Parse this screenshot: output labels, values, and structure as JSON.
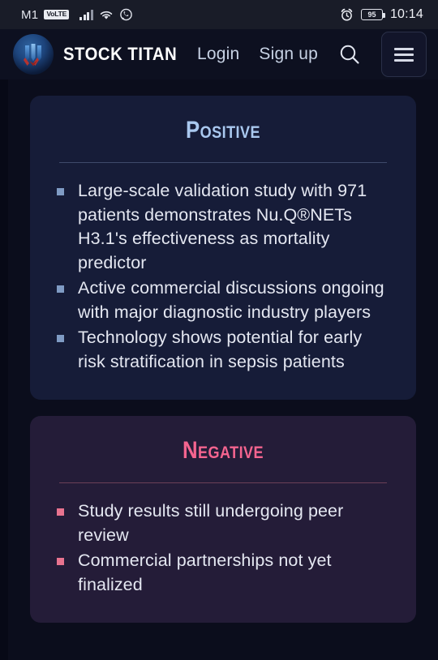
{
  "statusbar": {
    "carrier": "M1",
    "volte_badge": "VoLTE",
    "signal_icon": "signal-bars-icon",
    "wifi_icon": "wifi-icon",
    "whatsapp_icon": "whatsapp-icon",
    "alarm_icon": "alarm-clock-icon",
    "battery_level": "95",
    "time": "10:14"
  },
  "header": {
    "logo_icon": "stock-titan-logo-icon",
    "brand": "STOCK TITAN",
    "login_label": "Login",
    "signup_label": "Sign up",
    "search_icon": "search-icon",
    "menu_icon": "hamburger-menu-icon"
  },
  "cards": [
    {
      "id": "positive",
      "title": "Positive",
      "accent": "#a9c8ef",
      "bullet_color": "#7f9bc4",
      "background": "#161c38",
      "items": [
        "Large-scale validation study with 971 patients demonstrates Nu.Q®NETs H3.1's effectiveness as mortality predictor",
        "Active commercial discussions ongoing with major diagnostic industry players",
        "Technology shows potential for early risk stratification in sepsis patients"
      ]
    },
    {
      "id": "negative",
      "title": "Negative",
      "accent": "#f4648f",
      "bullet_color": "#e8738f",
      "background": "#241c38",
      "items": [
        "Study results still undergoing peer review",
        "Commercial partnerships not yet finalized"
      ]
    }
  ]
}
